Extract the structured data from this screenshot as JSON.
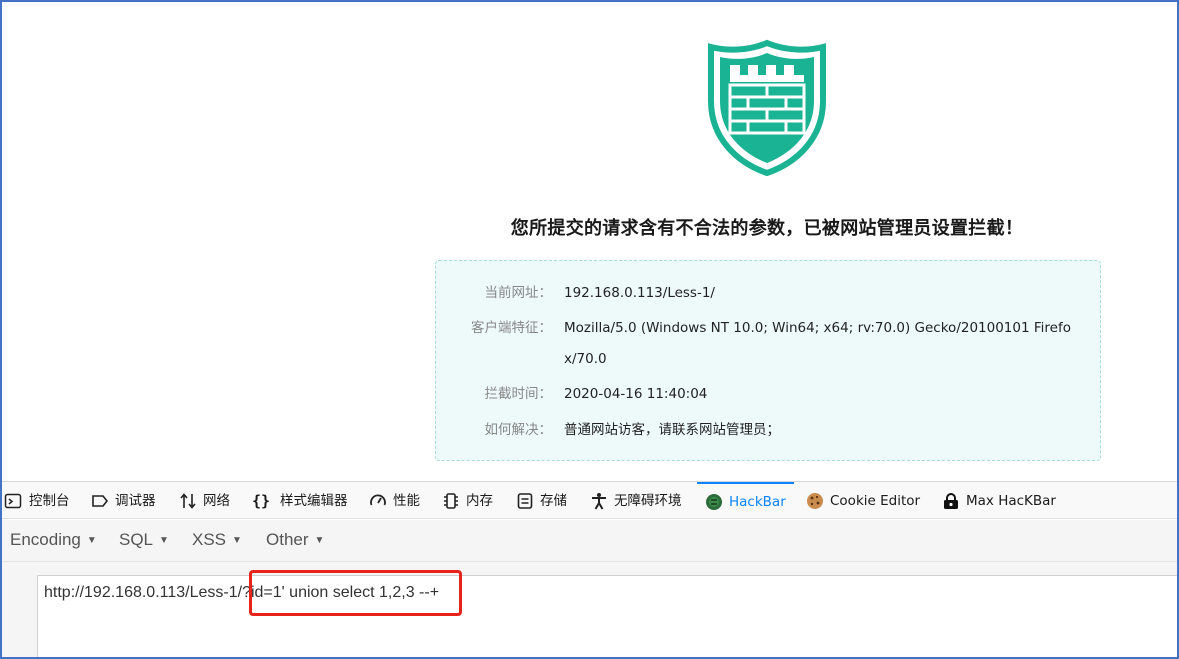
{
  "waf": {
    "title": "您所提交的请求含有不合法的参数，已被网站管理员设置拦截！",
    "rows": [
      {
        "label": "当前网址：",
        "value": "192.168.0.113/Less-1/"
      },
      {
        "label": "客户端特征：",
        "value": "Mozilla/5.0 (Windows NT 10.0; Win64; x64; rv:70.0) Gecko/20100101 Firefox/70.0"
      },
      {
        "label": "拦截时间：",
        "value": "2020-04-16 11:40:04"
      },
      {
        "label": "如何解决：",
        "value": "普通网站访客，请联系网站管理员；"
      }
    ],
    "colors": {
      "shield": "#1ab394",
      "box_bg": "#eefafa"
    }
  },
  "devtools": {
    "tabs": [
      {
        "label": "控制台",
        "icon": "console-icon"
      },
      {
        "label": "调试器",
        "icon": "debugger-icon"
      },
      {
        "label": "网络",
        "icon": "network-icon"
      },
      {
        "label": "样式编辑器",
        "icon": "style-editor-icon"
      },
      {
        "label": "性能",
        "icon": "performance-icon"
      },
      {
        "label": "内存",
        "icon": "memory-icon"
      },
      {
        "label": "存储",
        "icon": "storage-icon"
      },
      {
        "label": "无障碍环境",
        "icon": "accessibility-icon"
      },
      {
        "label": "HackBar",
        "icon": "hackbar-icon",
        "active": true
      },
      {
        "label": "Cookie Editor",
        "icon": "cookie-icon"
      },
      {
        "label": "Max HacKBar",
        "icon": "max-hackbar-icon"
      }
    ],
    "accent": "#0a84ff"
  },
  "hackbar": {
    "menus": [
      "Encoding",
      "SQL",
      "XSS",
      "Other"
    ],
    "url": "http://192.168.0.113/Less-1/?id=1' union select 1,2,3 --+",
    "highlight_color": "#e8231b"
  }
}
